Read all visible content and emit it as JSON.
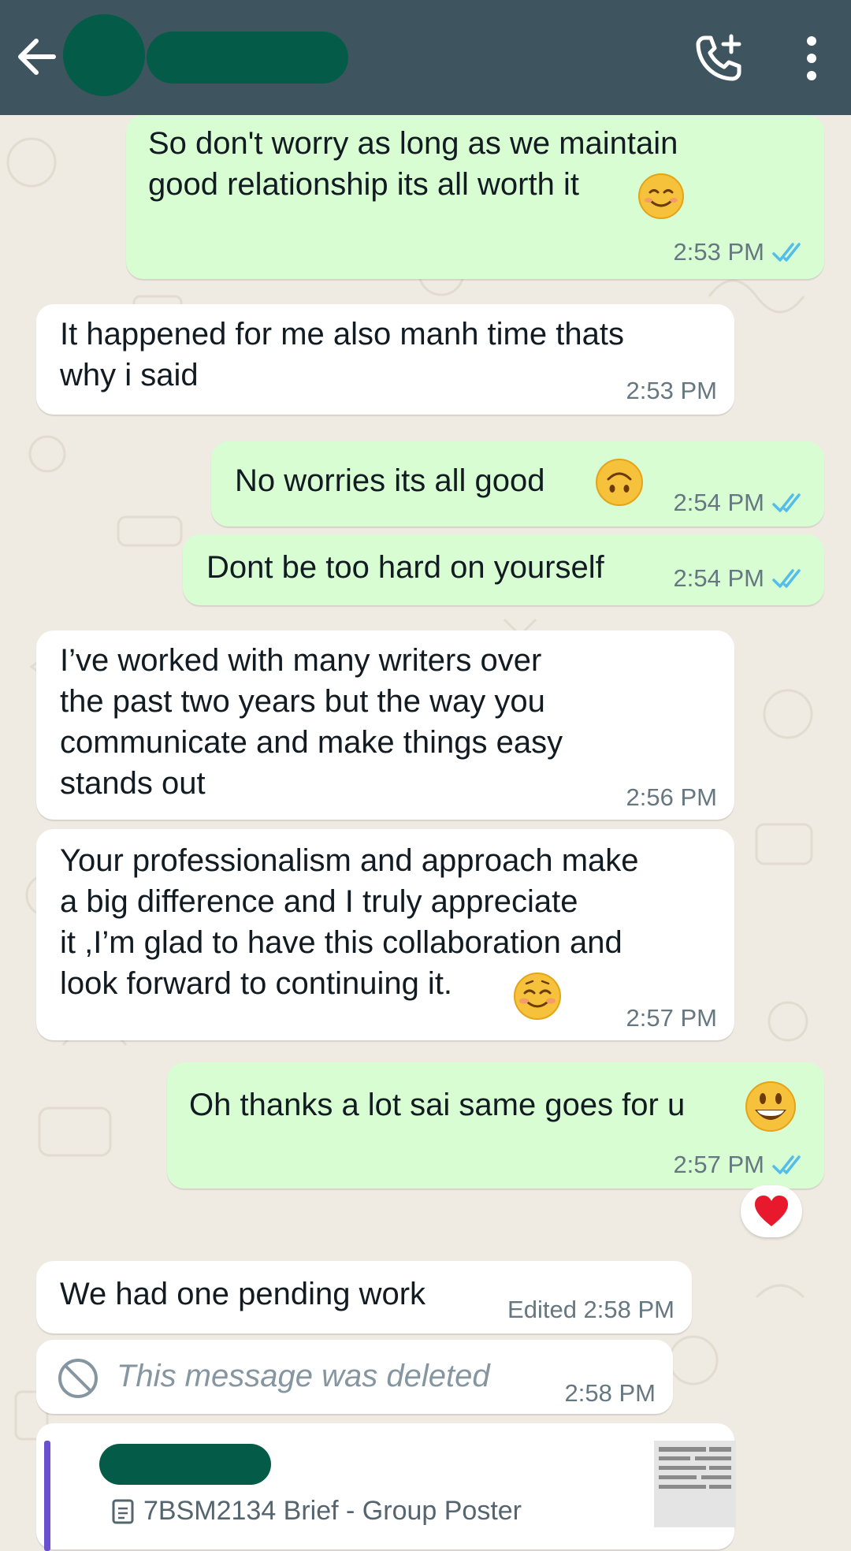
{
  "header": {
    "back_icon": "arrow-left-icon",
    "call_icon": "add-call-icon",
    "menu_icon": "more-vert-icon"
  },
  "messages": [
    {
      "id": "m1",
      "direction": "outgoing",
      "text": "So don't worry as long as we maintain\ngood relationship its all worth it",
      "emoji": "smiling-face-icon",
      "time": "2:53 PM",
      "status": "read"
    },
    {
      "id": "m2",
      "direction": "incoming",
      "text": "It happened for me also manh time thats\nwhy i said",
      "time": "2:53 PM"
    },
    {
      "id": "m3",
      "direction": "outgoing",
      "text": "No worries its all good",
      "emoji": "upside-down-face-icon",
      "time": "2:54 PM",
      "status": "read"
    },
    {
      "id": "m4",
      "direction": "outgoing",
      "text": "Dont be too hard on yourself",
      "time": "2:54 PM",
      "status": "read"
    },
    {
      "id": "m5",
      "direction": "incoming",
      "text": "I’ve worked with many writers over\nthe past two years but the way you\ncommunicate and make things easy\nstands out",
      "time": "2:56 PM"
    },
    {
      "id": "m6",
      "direction": "incoming",
      "text": "Your professionalism and approach make\na big difference and I truly appreciate\nit ,I’m glad to have this collaboration and\nlook forward to continuing it.",
      "emoji": "smiling-blush-icon",
      "time": "2:57 PM"
    },
    {
      "id": "m7",
      "direction": "outgoing",
      "text": "Oh thanks a lot sai same goes for u",
      "emoji": "grinning-face-icon",
      "time": "2:57 PM",
      "status": "read",
      "reaction": "red-heart-icon"
    },
    {
      "id": "m8",
      "direction": "incoming",
      "text": "We had one pending work",
      "time": "Edited 2:58 PM"
    },
    {
      "id": "m9",
      "direction": "incoming",
      "deleted": true,
      "text": "This message was deleted",
      "icon": "blocked-icon",
      "time": "2:58 PM"
    }
  ],
  "document": {
    "title": "7BSM2134 Brief - Group Poster",
    "icon": "document-icon"
  },
  "colors": {
    "header": "#3e5560",
    "outgoing_bubble": "#d9fdd3",
    "incoming_bubble": "#ffffff",
    "read_ticks": "#53bdeb",
    "background": "#efeae2"
  }
}
